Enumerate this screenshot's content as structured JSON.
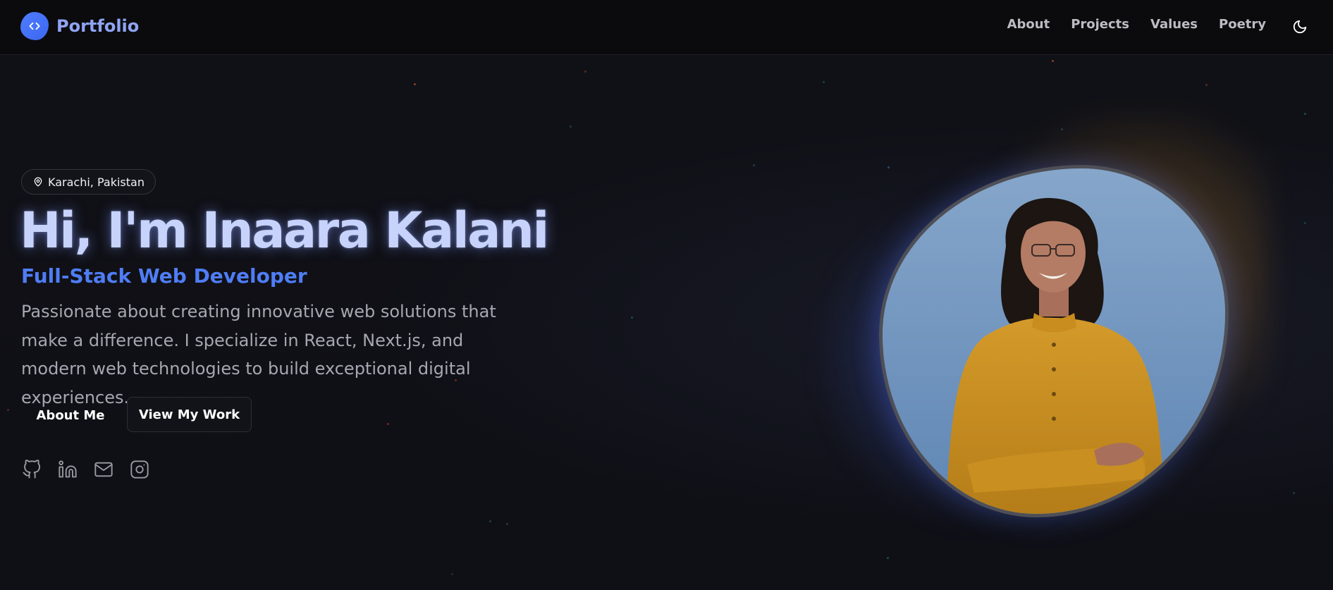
{
  "header": {
    "brand_name": "Portfolio",
    "nav": [
      "About",
      "Projects",
      "Values",
      "Poetry"
    ]
  },
  "hero": {
    "location": "Karachi, Pakistan",
    "title": "Hi, I'm Inaara Kalani",
    "subtitle": "Full-Stack Web Developer",
    "description": "Passionate about creating innovative web solutions that make a difference. I specialize in React, Next.js, and modern web technologies to build exceptional digital experiences.",
    "primary_button": "About Me",
    "secondary_button": "View My Work"
  },
  "socials": [
    "github-icon",
    "linkedin-icon",
    "mail-icon",
    "instagram-icon"
  ],
  "colors": {
    "background": "#0f1016",
    "accent": "#4f7df5",
    "title": "#c7d3fb",
    "body_text": "#a6a7b0"
  }
}
